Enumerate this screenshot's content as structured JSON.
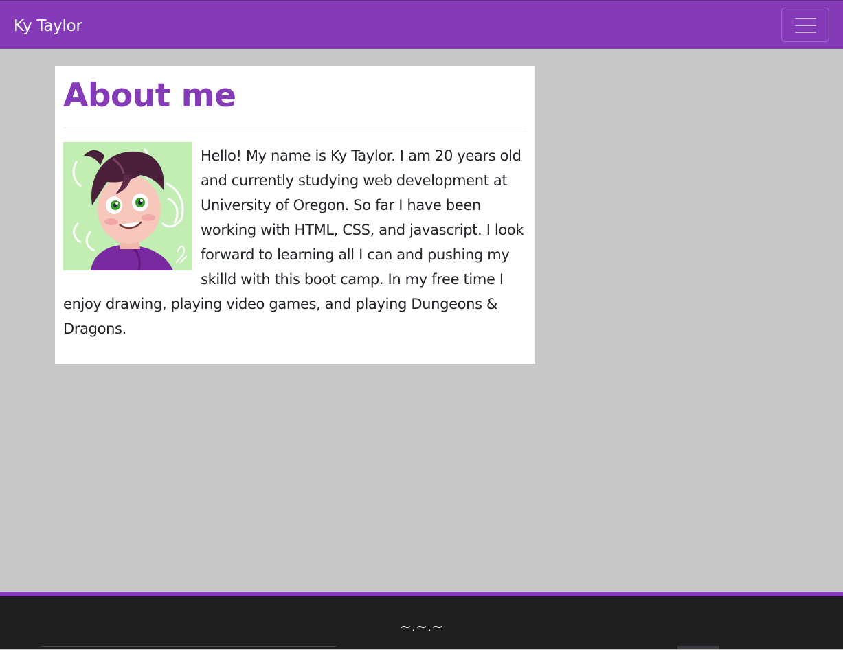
{
  "navbar": {
    "brand": "Ky Taylor",
    "toggler_icon": "hamburger-menu-icon",
    "color": "#853bb8"
  },
  "about": {
    "title": "About me",
    "image_alt": "Illustrated portrait of Ky Taylor",
    "bio": "Hello! My name is Ky Taylor. I am 20 years old and currently studying web development at University of Oregon. So far I have been working with HTML, CSS, and javascript. I look forward to learning all I can and pushing my skilld with this boot camp. In my free time I enjoy drawing, playing video games, and playing Dungeons & Dragons."
  },
  "footer": {
    "mark": "~.~.~"
  },
  "colors": {
    "accent": "#853bb8",
    "page_background": "#c8c8c8",
    "footer_background": "#1e1e1e"
  }
}
